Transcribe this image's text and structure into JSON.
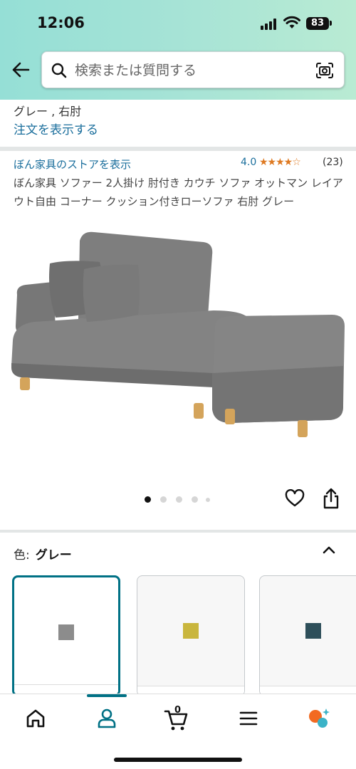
{
  "status_bar": {
    "time": "12:06",
    "battery": "83"
  },
  "search": {
    "placeholder": "検索または質問する",
    "back_icon": "arrow-left-icon",
    "search_icon": "magnifier-icon",
    "camera_icon": "camera-scan-icon"
  },
  "order": {
    "variant": "グレー , 右肘",
    "view_order_label": "注文を表示する"
  },
  "product": {
    "store_link": "ぼん家具のストアを表示",
    "rating_value": "4.0",
    "rating_stars": 4,
    "review_count": "(23)",
    "title": "ぼん家具 ソファー 2人掛け 肘付き カウチ ソファ オットマン レイアウト自由 コーナー クッション付きローソファ 右肘 グレー",
    "image_icon": "sofa-photo",
    "carousel_pages": 5,
    "carousel_active": 0
  },
  "variation": {
    "color_label": "色:",
    "color_value": "グレー",
    "swatches": [
      {
        "color": "#8c8c8c",
        "selected": true
      },
      {
        "color": "#c9b63d",
        "selected": false
      },
      {
        "color": "#2e4f5a",
        "selected": false
      }
    ]
  },
  "tab_bar": {
    "active_tab": "account",
    "cart_count": "0",
    "tabs": [
      "home-icon",
      "account-icon",
      "cart-icon",
      "menu-icon",
      "ai-assistant-icon"
    ]
  },
  "colors": {
    "accent": "#007185",
    "link": "#1a6e9c",
    "star": "#de7921",
    "header_gradient_start": "#95dfd6",
    "header_gradient_end": "#b9ebd3"
  }
}
